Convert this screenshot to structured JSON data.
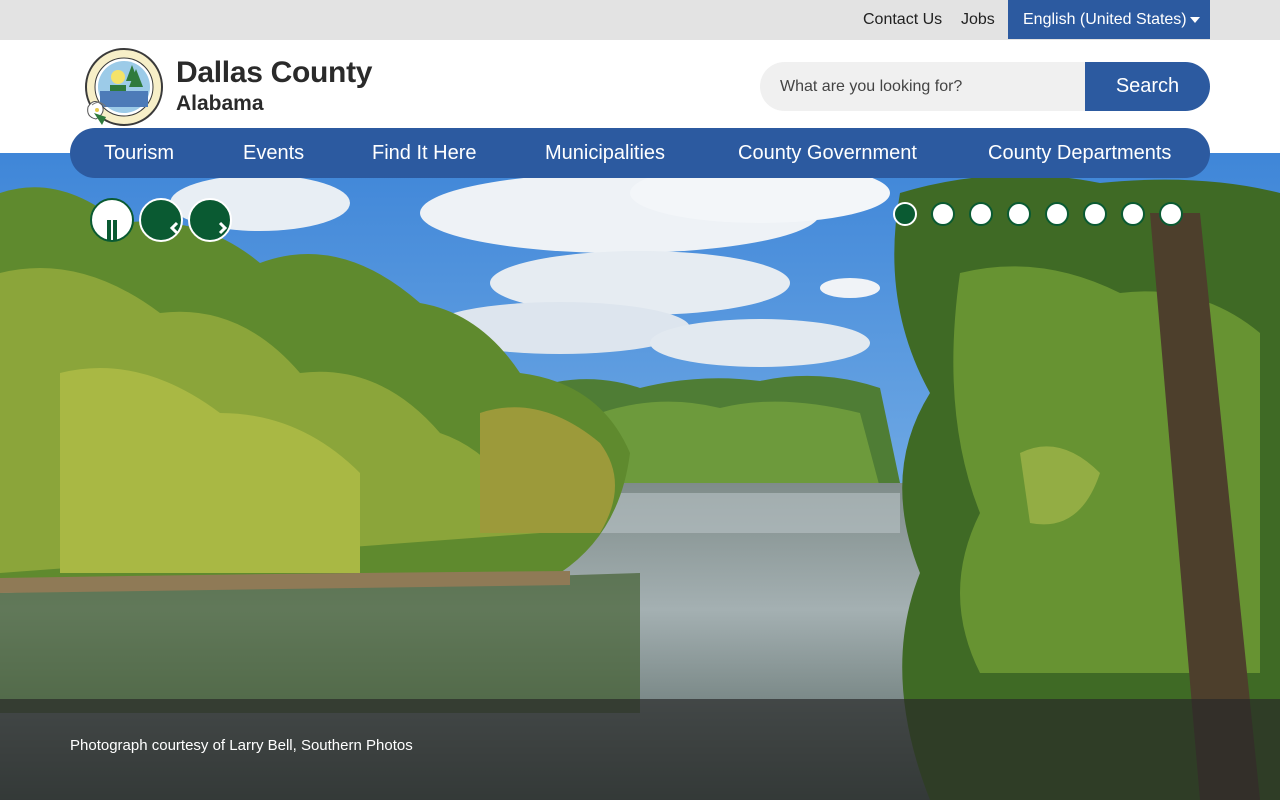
{
  "utility": {
    "contact_label": "Contact Us",
    "jobs_label": "Jobs",
    "language_label": "English (United States)"
  },
  "brand": {
    "title": "Dallas County",
    "subtitle": "Alabama",
    "seal_text": "DALLAS COUNTY ALABAMA"
  },
  "search": {
    "placeholder": "What are you looking for?",
    "button_label": "Search"
  },
  "nav": {
    "items": [
      {
        "label": "Tourism"
      },
      {
        "label": "Events"
      },
      {
        "label": "Find It Here"
      },
      {
        "label": "Municipalities"
      },
      {
        "label": "County Government"
      },
      {
        "label": "County Departments"
      }
    ]
  },
  "slider": {
    "dot_count": 8,
    "active_index": 0,
    "controls": [
      "pause-icon",
      "chevron-left-icon",
      "chevron-right-icon"
    ]
  },
  "caption": {
    "text": "Photograph courtesy of Larry Bell, Southern Photos"
  },
  "colors": {
    "primary_blue": "#2c5aa0",
    "accent_green": "#0a5a32",
    "utility_gray": "#e3e3e3"
  }
}
